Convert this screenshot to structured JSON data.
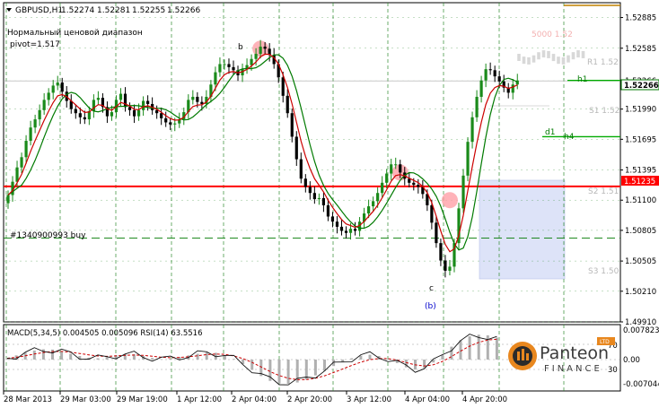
{
  "symbol": {
    "name": "GBPUSD,H1",
    "o": "1.52274",
    "h": "1.52281",
    "l": "1.52255",
    "c": "1.52266"
  },
  "caption": {
    "line1": "Нормальный ценовой диапазон",
    "line2": "pivot=1.517"
  },
  "order_label": "#1340900993 buy",
  "wave_labels": {
    "b": "b",
    "c": "c",
    "paren_b": "(b)"
  },
  "level_labels": {
    "h1": "h1",
    "d1": "d1",
    "h4": "h4",
    "r1": "R1 1.52",
    "s1": "S1 1.52",
    "s2": "S2 1.51",
    "s3": "S3 1.50",
    "faint": "5000 1.52"
  },
  "price_badges": {
    "current": "1.52266",
    "red_line": "1.51235"
  },
  "indicator": {
    "title": "MACD(5,34,5) 0.004505 0.005096  RSI(14) 63.5516",
    "top": "0.007823",
    "zero": "0.00",
    "bottom": "-0.007044",
    "rsi_70": "70",
    "rsi_30": "30"
  },
  "branding": {
    "name": "Panteon",
    "sub": "FINANCE",
    "badge": "LTD"
  },
  "colors": {
    "bull": "#1a8a1a",
    "bear": "#000000",
    "fast_ma": "#cc0000",
    "slow_ma": "#007a00",
    "red_level": "#ff0000",
    "grid": "#2e8b2e",
    "target_zone": "#dde3f8",
    "highlight": "#ff9aa2",
    "wave_b": "#0000cc"
  },
  "chart_data": {
    "type": "candlestick",
    "instrument": "GBPUSD",
    "timeframe": "H1",
    "x_labels": [
      "28 Mar 2013",
      "29 Mar 03:00",
      "29 Mar 19:00",
      "1 Apr 12:00",
      "2 Apr 04:00",
      "2 Apr 20:00",
      "3 Apr 12:00",
      "4 Apr 04:00",
      "4 Apr 20:00"
    ],
    "y_ticks": [
      "1.52885",
      "1.52585",
      "1.52266",
      "1.51990",
      "1.51695",
      "1.51395",
      "1.51100",
      "1.50805",
      "1.50505",
      "1.50210",
      "1.49910"
    ],
    "ylim": [
      1.4991,
      1.5303
    ],
    "close": [
      1.5115,
      1.5128,
      1.5142,
      1.5152,
      1.5168,
      1.5181,
      1.5189,
      1.5198,
      1.5208,
      1.5215,
      1.5222,
      1.5225,
      1.5216,
      1.5207,
      1.5199,
      1.5195,
      1.5191,
      1.5189,
      1.5197,
      1.5208,
      1.521,
      1.5201,
      1.5192,
      1.5196,
      1.5208,
      1.5214,
      1.5201,
      1.5198,
      1.5192,
      1.5198,
      1.5207,
      1.5204,
      1.5198,
      1.5195,
      1.519,
      1.5186,
      1.5184,
      1.5185,
      1.5189,
      1.5196,
      1.5208,
      1.5211,
      1.5206,
      1.5204,
      1.5211,
      1.5223,
      1.5235,
      1.5243,
      1.5243,
      1.524,
      1.5237,
      1.5232,
      1.5238,
      1.5242,
      1.5248,
      1.5253,
      1.526,
      1.5258,
      1.5252,
      1.5243,
      1.523,
      1.5212,
      1.5195,
      1.5172,
      1.515,
      1.5131,
      1.5123,
      1.5117,
      1.5111,
      1.5112,
      1.5105,
      1.5094,
      1.5089,
      1.5084,
      1.508,
      1.5078,
      1.5082,
      1.508,
      1.5089,
      1.5097,
      1.5104,
      1.5109,
      1.5117,
      1.5127,
      1.5136,
      1.5145,
      1.5145,
      1.5137,
      1.5131,
      1.5127,
      1.5125,
      1.5123,
      1.5116,
      1.5105,
      1.5088,
      1.5068,
      1.5051,
      1.5041,
      1.5045,
      1.5068,
      1.5102,
      1.5134,
      1.5167,
      1.5191,
      1.5211,
      1.5227,
      1.5238,
      1.5237,
      1.5231,
      1.5226,
      1.522,
      1.5215,
      1.5223,
      1.5227
    ],
    "fast_ma_label": "red MA",
    "slow_ma_label": "green MA",
    "horizontal_levels": {
      "red_line": 1.51235,
      "current": 1.52266,
      "order_buy": 1.5073,
      "h1": 1.5227,
      "d1_h4": 1.5172
    },
    "highlights": [
      {
        "x_index": 56,
        "y": 1.5258
      },
      {
        "x_index": 87,
        "y": 1.5137
      },
      {
        "x_index": 98,
        "y": 1.511
      }
    ],
    "macd": [
      0.0004,
      0.0013,
      0.0021,
      0.0028,
      0.0032,
      0.0031,
      0.0026,
      0.0018,
      0.0011,
      0.0006,
      0.0004,
      0.0008,
      0.0014,
      0.0017,
      0.0016,
      0.0011,
      0.0005,
      0.0001,
      0.0003,
      0.0008,
      0.0013,
      0.0018,
      0.0022,
      0.0021,
      0.0014,
      0.0002,
      -0.0014,
      -0.0032,
      -0.0051,
      -0.0066,
      -0.0074,
      -0.0075,
      -0.0071,
      -0.0062,
      -0.0049,
      -0.0035,
      -0.002,
      -0.0007,
      0.0004,
      0.0012,
      0.0015,
      0.0011,
      0.0002,
      -0.0011,
      -0.0024,
      -0.0031,
      -0.0026,
      -0.0009,
      0.0015,
      0.004,
      0.006,
      0.0072,
      0.0077,
      0.0075,
      0.0068
    ]
  }
}
